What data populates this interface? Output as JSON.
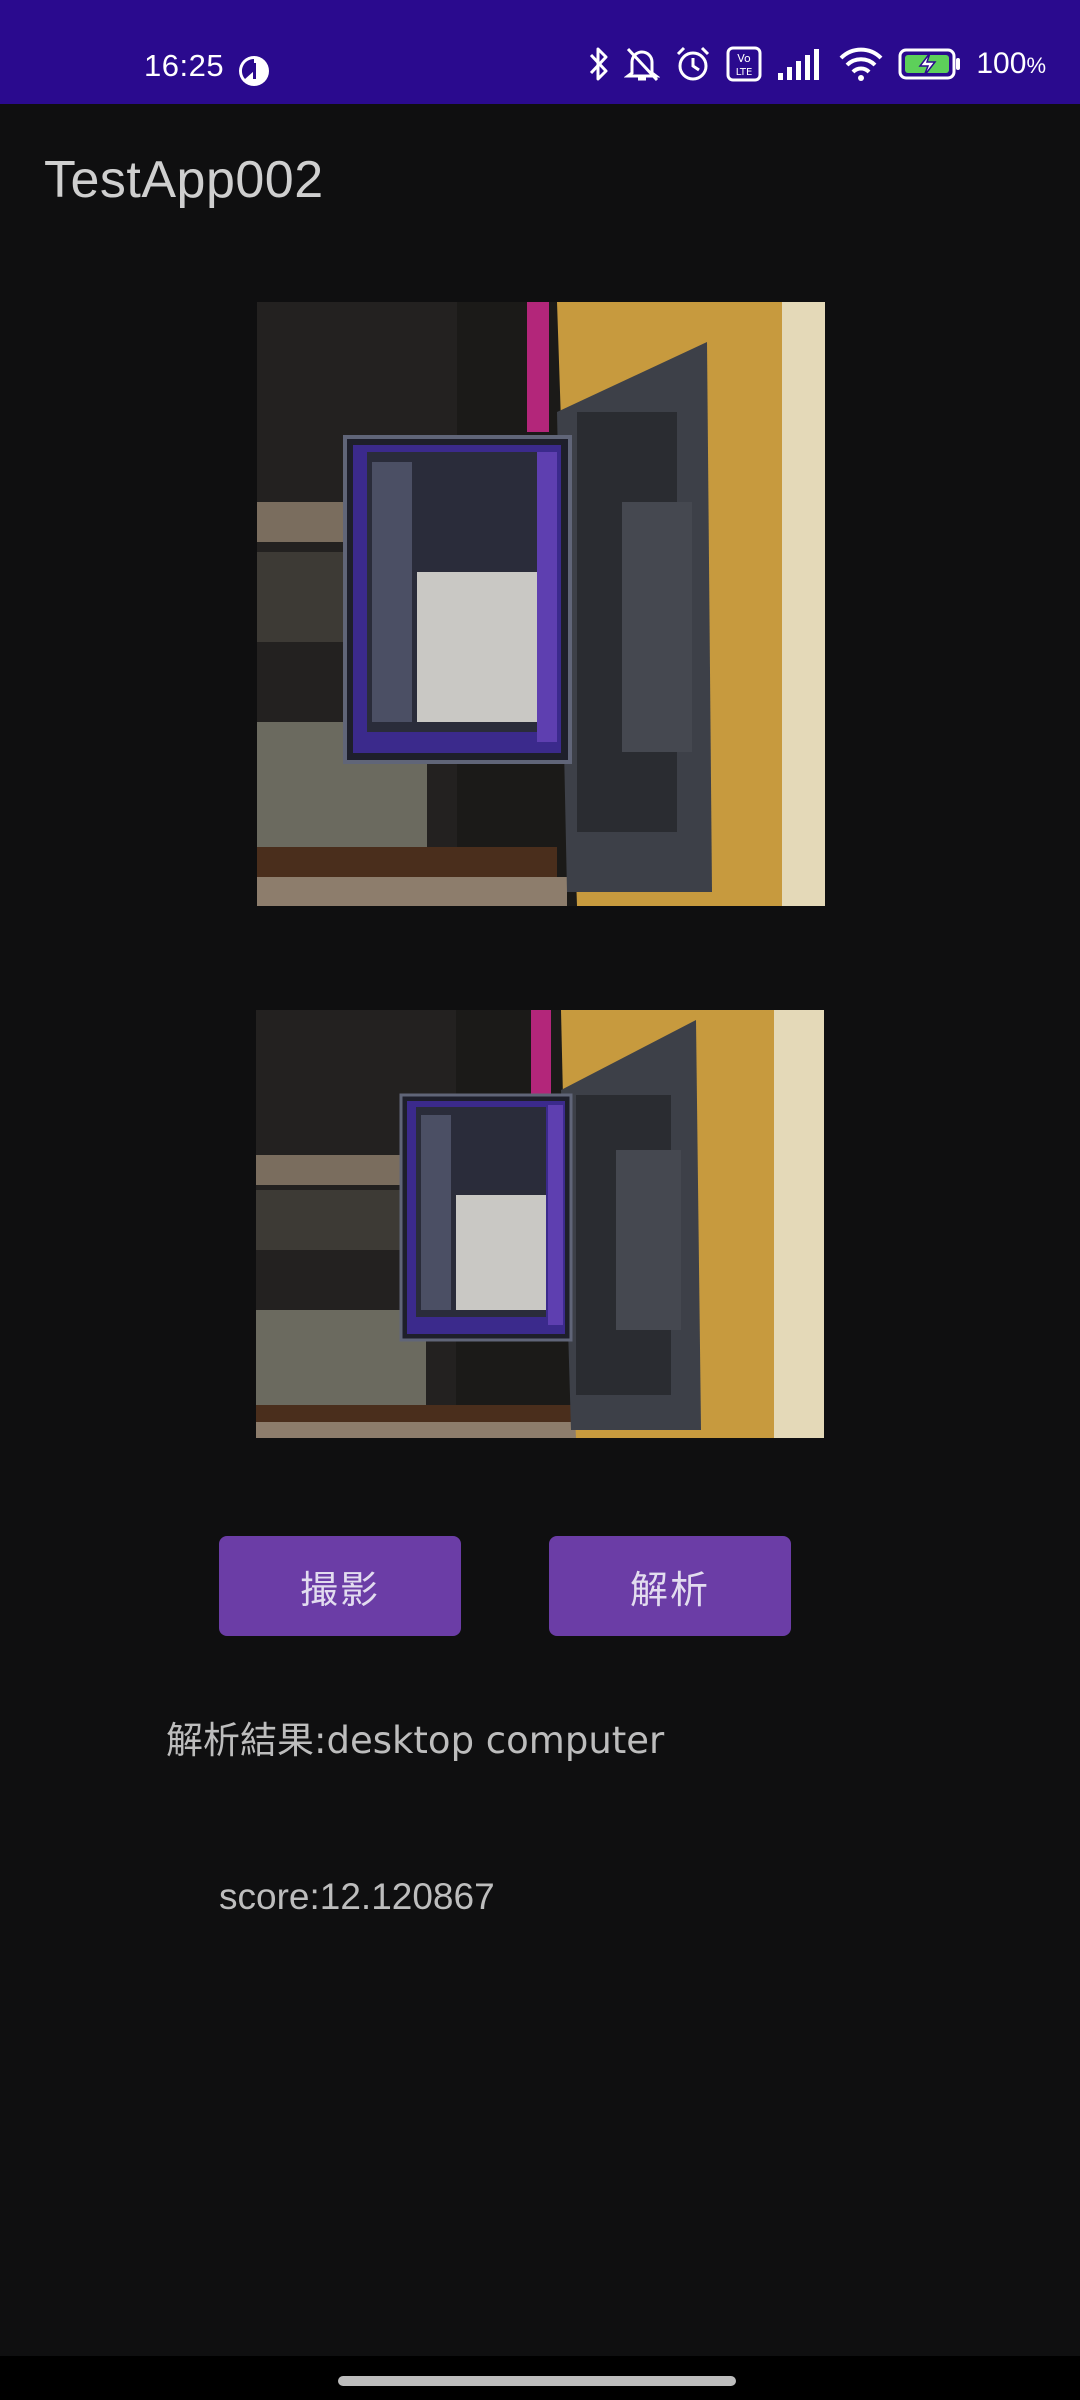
{
  "status_bar": {
    "time": "16:25",
    "battery": "100",
    "battery_unit": "%",
    "background": "#2a0a8e",
    "icons": [
      "pie-status-icon",
      "bluetooth-icon",
      "mute-icon",
      "alarm-icon",
      "volte-icon",
      "signal-icon",
      "wifi-icon",
      "battery-charging-icon"
    ]
  },
  "app": {
    "title": "TestApp002"
  },
  "buttons": {
    "capture_label": "撮影",
    "analyze_label": "解析",
    "color": "#6b3da6"
  },
  "result": {
    "label": "解析結果:desktop computer",
    "score": "score:12.120867"
  }
}
